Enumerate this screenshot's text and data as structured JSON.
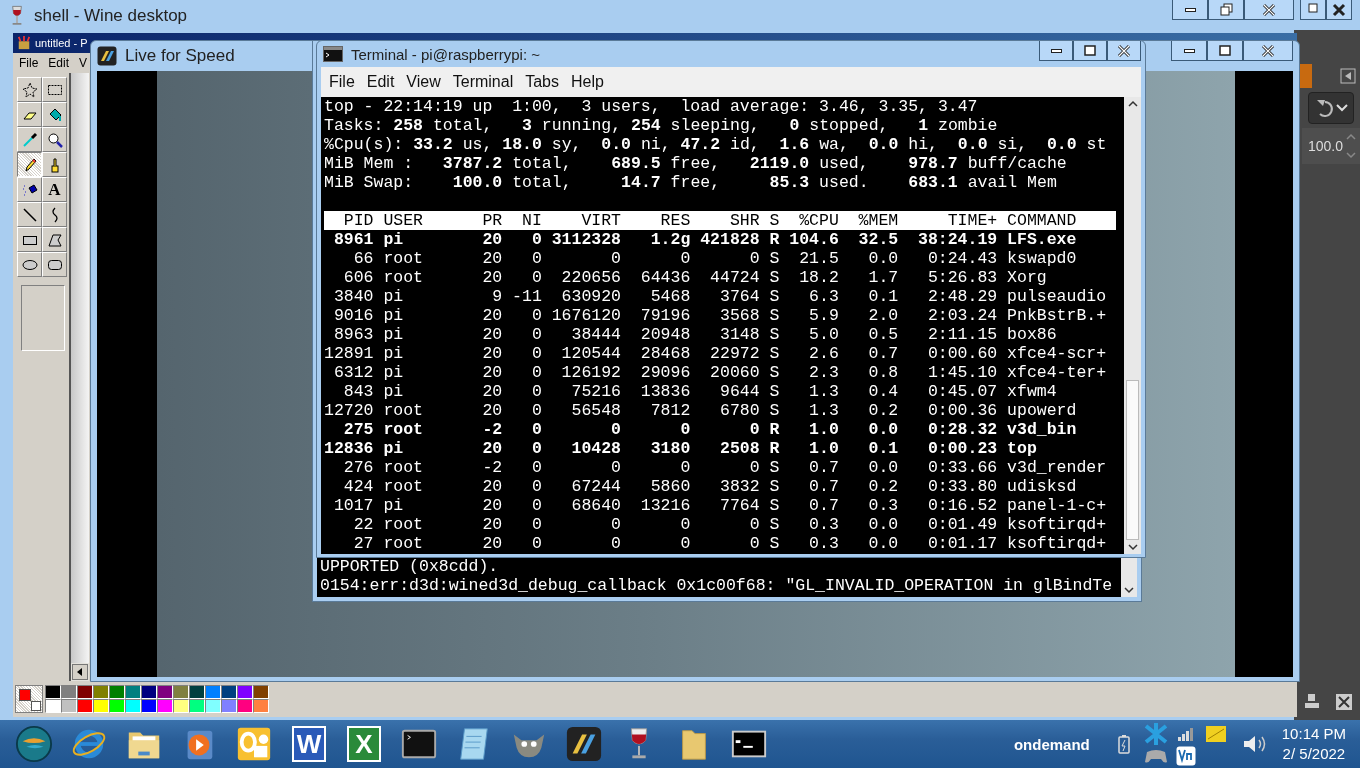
{
  "desktop": {
    "title": "shell - Wine desktop"
  },
  "paint": {
    "title": "untitled - P",
    "menu": [
      "File",
      "Edit",
      "V"
    ],
    "tools": [
      {
        "kind": "free-select",
        "selected": false
      },
      {
        "kind": "rect-select",
        "selected": false
      },
      {
        "kind": "eraser",
        "selected": false
      },
      {
        "kind": "fill",
        "selected": false
      },
      {
        "kind": "picker",
        "selected": false
      },
      {
        "kind": "magnifier",
        "selected": false
      },
      {
        "kind": "pencil",
        "selected": true
      },
      {
        "kind": "brush",
        "selected": false
      },
      {
        "kind": "airbrush",
        "selected": false
      },
      {
        "kind": "text",
        "selected": false,
        "glyph": "A"
      },
      {
        "kind": "line",
        "selected": false
      },
      {
        "kind": "curve",
        "selected": false
      },
      {
        "kind": "rectangle",
        "selected": false
      },
      {
        "kind": "polygon",
        "selected": false
      },
      {
        "kind": "ellipse",
        "selected": false
      },
      {
        "kind": "rounded-rect",
        "selected": false
      }
    ],
    "current_colors": [
      {
        "color": "#ff0000"
      },
      {
        "color": "#ffffff"
      }
    ],
    "palette": [
      {
        "color": "#000000"
      },
      {
        "color": "#808080"
      },
      {
        "color": "#800000"
      },
      {
        "color": "#808000"
      },
      {
        "color": "#008000"
      },
      {
        "color": "#008080"
      },
      {
        "color": "#000080"
      },
      {
        "color": "#800080"
      },
      {
        "color": "#808040"
      },
      {
        "color": "#004040"
      },
      {
        "color": "#0080ff"
      },
      {
        "color": "#004080"
      },
      {
        "color": "#8000ff"
      },
      {
        "color": "#804000"
      },
      {
        "color": "#ffffff"
      },
      {
        "color": "#c0c0c0"
      },
      {
        "color": "#ff0000"
      },
      {
        "color": "#ffff00"
      },
      {
        "color": "#00ff00"
      },
      {
        "color": "#00ffff"
      },
      {
        "color": "#0000ff"
      },
      {
        "color": "#ff00ff"
      },
      {
        "color": "#ffff80"
      },
      {
        "color": "#00ff80"
      },
      {
        "color": "#80ffff"
      },
      {
        "color": "#8080ff"
      },
      {
        "color": "#ff0080"
      },
      {
        "color": "#ff8040"
      }
    ]
  },
  "lfs": {
    "title": "Live for Speed"
  },
  "back_terminal": {
    "lines": [
      "UPPORTED (0x8cdd).",
      "0154:err:d3d:wined3d_debug_callback 0x1c00f68: \"GL_INVALID_OPERATION in glBindTe"
    ]
  },
  "terminal": {
    "title": "Terminal - pi@raspberrypi: ~",
    "menu": [
      "File",
      "Edit",
      "View",
      "Terminal",
      "Tabs",
      "Help"
    ],
    "summary": [
      "top - 22:14:19 up  1:00,  3 users,  load average: 3.46, 3.35, 3.47",
      "Tasks: **258** total,   **3** running, **254** sleeping,   **0** stopped,   **1** zombie",
      "%Cpu(s): **33.2** us, **18.0** sy,  **0.0** ni, **47.2** id,  **1.6** wa,  **0.0** hi,  **0.0** si,  **0.0** st",
      "MiB Mem :   **3787.2** total,    **689.5** free,   **2119.0** used,    **978.7** buff/cache",
      "MiB Swap:    **100.0** total,     **14.7** free,     **85.3** used.    **683.1** avail Mem"
    ],
    "columns": [
      "PID",
      "USER",
      "PR",
      "NI",
      "VIRT",
      "RES",
      "SHR",
      "S",
      "%CPU",
      "%MEM",
      "TIME+",
      "COMMAND"
    ],
    "rows": [
      {
        "cells": [
          "8961",
          "pi",
          "20",
          "0",
          "3112328",
          "1.2g",
          "421828",
          "R",
          "104.6",
          "32.5",
          "38:24.19",
          "LFS.exe"
        ],
        "bold": true
      },
      {
        "cells": [
          "66",
          "root",
          "20",
          "0",
          "0",
          "0",
          "0",
          "S",
          "21.5",
          "0.0",
          "0:24.43",
          "kswapd0"
        ],
        "bold": false
      },
      {
        "cells": [
          "606",
          "root",
          "20",
          "0",
          "220656",
          "64436",
          "44724",
          "S",
          "18.2",
          "1.7",
          "5:26.83",
          "Xorg"
        ],
        "bold": false
      },
      {
        "cells": [
          "3840",
          "pi",
          "9",
          "-11",
          "630920",
          "5468",
          "3764",
          "S",
          "6.3",
          "0.1",
          "2:48.29",
          "pulseaudio"
        ],
        "bold": false
      },
      {
        "cells": [
          "9016",
          "pi",
          "20",
          "0",
          "1676120",
          "79196",
          "3568",
          "S",
          "5.9",
          "2.0",
          "2:03.24",
          "PnkBstrB.+"
        ],
        "bold": false
      },
      {
        "cells": [
          "8963",
          "pi",
          "20",
          "0",
          "38444",
          "20948",
          "3148",
          "S",
          "5.0",
          "0.5",
          "2:11.15",
          "box86"
        ],
        "bold": false
      },
      {
        "cells": [
          "12891",
          "pi",
          "20",
          "0",
          "120544",
          "28468",
          "22972",
          "S",
          "2.6",
          "0.7",
          "0:00.60",
          "xfce4-scr+"
        ],
        "bold": false
      },
      {
        "cells": [
          "6312",
          "pi",
          "20",
          "0",
          "126192",
          "29096",
          "20060",
          "S",
          "2.3",
          "0.8",
          "1:45.10",
          "xfce4-ter+"
        ],
        "bold": false
      },
      {
        "cells": [
          "843",
          "pi",
          "20",
          "0",
          "75216",
          "13836",
          "9644",
          "S",
          "1.3",
          "0.4",
          "0:45.07",
          "xfwm4"
        ],
        "bold": false
      },
      {
        "cells": [
          "12720",
          "root",
          "20",
          "0",
          "56548",
          "7812",
          "6780",
          "S",
          "1.3",
          "0.2",
          "0:00.36",
          "upowerd"
        ],
        "bold": false
      },
      {
        "cells": [
          "275",
          "root",
          "-2",
          "0",
          "0",
          "0",
          "0",
          "R",
          "1.0",
          "0.0",
          "0:28.32",
          "v3d_bin"
        ],
        "bold": true
      },
      {
        "cells": [
          "12836",
          "pi",
          "20",
          "0",
          "10428",
          "3180",
          "2508",
          "R",
          "1.0",
          "0.1",
          "0:00.23",
          "top"
        ],
        "bold": true
      },
      {
        "cells": [
          "276",
          "root",
          "-2",
          "0",
          "0",
          "0",
          "0",
          "S",
          "0.7",
          "0.0",
          "0:33.66",
          "v3d_render"
        ],
        "bold": false
      },
      {
        "cells": [
          "424",
          "root",
          "20",
          "0",
          "67244",
          "5860",
          "3832",
          "S",
          "0.7",
          "0.2",
          "0:33.80",
          "udisksd"
        ],
        "bold": false
      },
      {
        "cells": [
          "1017",
          "pi",
          "20",
          "0",
          "68640",
          "13216",
          "7764",
          "S",
          "0.7",
          "0.3",
          "0:16.52",
          "panel-1-c+"
        ],
        "bold": false
      },
      {
        "cells": [
          "22",
          "root",
          "20",
          "0",
          "0",
          "0",
          "0",
          "S",
          "0.3",
          "0.0",
          "0:01.49",
          "ksoftirqd+"
        ],
        "bold": false
      },
      {
        "cells": [
          "27",
          "root",
          "20",
          "0",
          "0",
          "0",
          "0",
          "S",
          "0.3",
          "0.0",
          "0:01.17",
          "ksoftirqd+"
        ],
        "bold": false
      }
    ]
  },
  "side_panel": {
    "value": "100.0"
  },
  "taskbar": {
    "apps": [
      {
        "kind": "orb"
      },
      {
        "kind": "browser"
      },
      {
        "kind": "folder"
      },
      {
        "kind": "media"
      },
      {
        "kind": "mail"
      },
      {
        "kind": "word",
        "glyph": "W"
      },
      {
        "kind": "sheet",
        "glyph": "X"
      },
      {
        "kind": "terminal"
      },
      {
        "kind": "notepad"
      },
      {
        "kind": "cat"
      },
      {
        "kind": "lfs"
      },
      {
        "kind": "wine"
      },
      {
        "kind": "plain-folder"
      },
      {
        "kind": "cmd"
      }
    ],
    "governor": "ondemand",
    "time": "10:14 PM",
    "date": "2/ 5/2022"
  }
}
